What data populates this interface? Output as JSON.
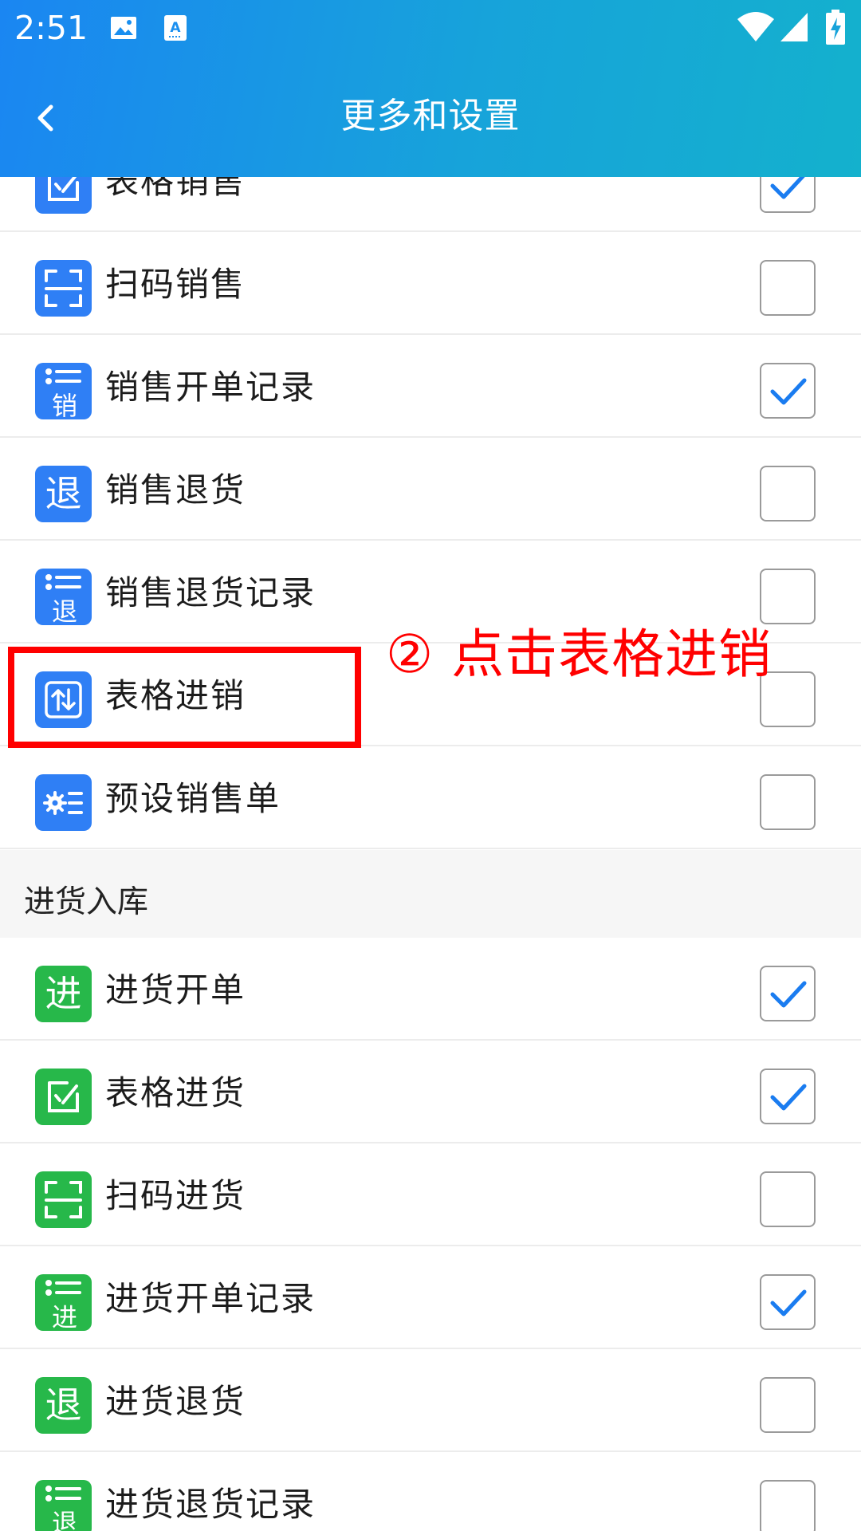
{
  "status_bar": {
    "time": "2:51",
    "icons": [
      "image-icon",
      "keyboard-icon",
      "wifi-icon",
      "signal-icon",
      "battery-charging-icon"
    ]
  },
  "header": {
    "title": "更多和设置",
    "back_icon": "chevron-left-icon"
  },
  "colors": {
    "header_gradient_start": "#1a86f2",
    "header_gradient_end": "#14b1cd",
    "sales_icon": "#2f7ff5",
    "purchase_icon": "#27b84a",
    "check": "#1a7cf0",
    "annotation": "#ff0000"
  },
  "sales_items": [
    {
      "label": "表格销售",
      "icon": "form-edit-icon",
      "checked": true
    },
    {
      "label": "扫码销售",
      "icon": "scan-icon",
      "checked": false
    },
    {
      "label": "销售开单记录",
      "icon": "list-icon",
      "glyph": "销",
      "checked": true
    },
    {
      "label": "销售退货",
      "icon": "return-icon",
      "glyph": "退",
      "checked": false
    },
    {
      "label": "销售退货记录",
      "icon": "list-icon",
      "glyph": "退",
      "checked": false
    },
    {
      "label": "表格进销",
      "icon": "swap-icon",
      "checked": false
    },
    {
      "label": "预设销售单",
      "icon": "gear-list-icon",
      "checked": false
    }
  ],
  "purchase_section": {
    "title": "进货入库",
    "items": [
      {
        "label": "进货开单",
        "icon": "purchase-icon",
        "glyph": "进",
        "checked": true
      },
      {
        "label": "表格进货",
        "icon": "form-edit-icon",
        "checked": true
      },
      {
        "label": "扫码进货",
        "icon": "scan-icon",
        "checked": false
      },
      {
        "label": "进货开单记录",
        "icon": "list-icon",
        "glyph": "进",
        "checked": true
      },
      {
        "label": "进货退货",
        "icon": "return-icon",
        "glyph": "退",
        "checked": false
      },
      {
        "label": "进货退货记录",
        "icon": "list-icon",
        "glyph": "退",
        "checked": false
      }
    ]
  },
  "annotation": {
    "text": "② 点击表格进销"
  }
}
